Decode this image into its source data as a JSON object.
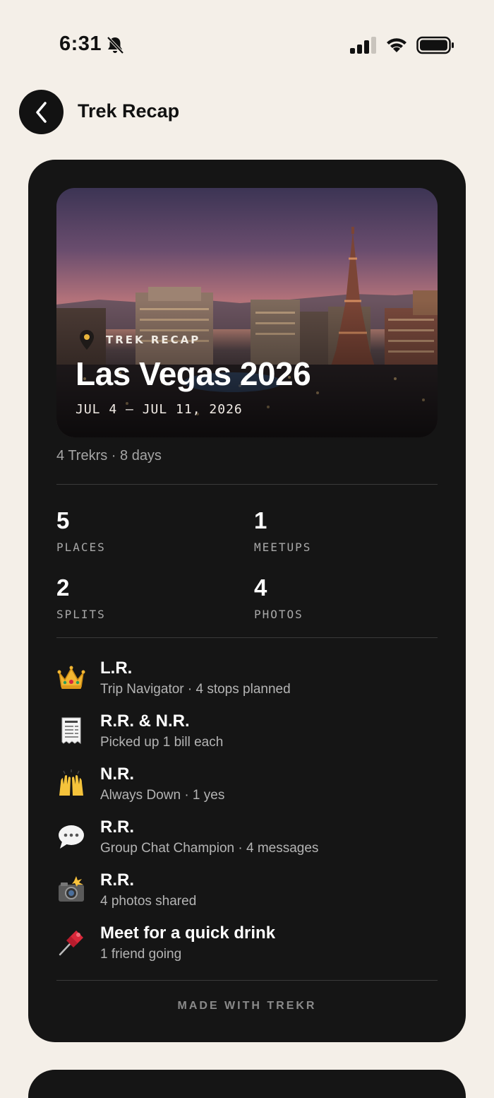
{
  "status": {
    "time": "6:31"
  },
  "header": {
    "title": "Trek Recap"
  },
  "hero": {
    "kicker": "TREK RECAP",
    "title": "Las Vegas 2026",
    "dates": "JUL 4 – JUL 11, 2026"
  },
  "meta": "4 Trekrs · 8 days",
  "stats": [
    {
      "value": "5",
      "label": "PLACES"
    },
    {
      "value": "1",
      "label": "MEETUPS"
    },
    {
      "value": "2",
      "label": "SPLITS"
    },
    {
      "value": "4",
      "label": "PHOTOS"
    }
  ],
  "awards": [
    {
      "icon": "crown-icon",
      "name": "L.R.",
      "sub": "Trip Navigator · 4 stops planned"
    },
    {
      "icon": "receipt-icon",
      "name": "R.R. & N.R.",
      "sub": "Picked up 1 bill each"
    },
    {
      "icon": "raised-hands-icon",
      "name": "N.R.",
      "sub": "Always Down · 1 yes"
    },
    {
      "icon": "speech-bubble-icon",
      "name": "R.R.",
      "sub": "Group Chat Champion · 4 messages"
    },
    {
      "icon": "camera-flash-icon",
      "name": "R.R.",
      "sub": "4 photos shared"
    },
    {
      "icon": "pushpin-icon",
      "name": "Meet for a quick drink",
      "sub": "1 friend going"
    }
  ],
  "footer": "MADE WITH TREKR"
}
